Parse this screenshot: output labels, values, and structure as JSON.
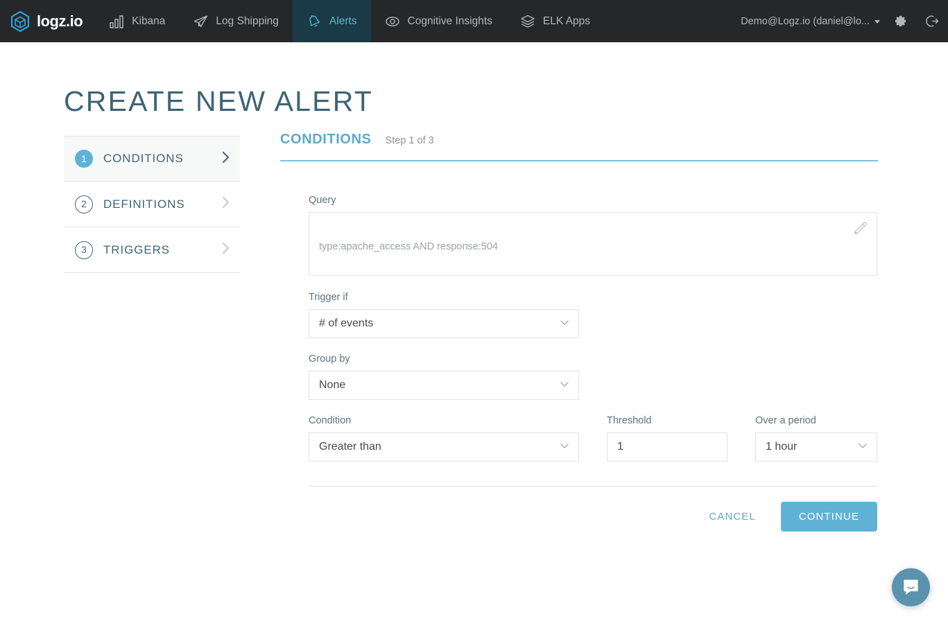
{
  "topnav": {
    "brand": {
      "text": "logz.io",
      "icon": "logzio-cube-icon"
    },
    "items": [
      {
        "label": "Kibana",
        "icon": "bar-chart-icon",
        "active": false
      },
      {
        "label": "Log Shipping",
        "icon": "paper-plane-icon",
        "active": false
      },
      {
        "label": "Alerts",
        "icon": "bell-icon",
        "active": true
      },
      {
        "label": "Cognitive Insights",
        "icon": "eye-icon",
        "active": false
      },
      {
        "label": "ELK Apps",
        "icon": "layers-icon",
        "active": false
      }
    ],
    "user": "Demo@Logz.io (daniel@lo...",
    "settings_icon": "gear-icon",
    "logout_icon": "logout-icon"
  },
  "page": {
    "title": "CREATE NEW ALERT"
  },
  "steps": [
    {
      "number": "1",
      "label": "CONDITIONS",
      "active": true
    },
    {
      "number": "2",
      "label": "DEFINITIONS",
      "active": false
    },
    {
      "number": "3",
      "label": "TRIGGERS",
      "active": false
    }
  ],
  "panel": {
    "title": "CONDITIONS",
    "step_indicator": "Step 1 of 3"
  },
  "form": {
    "query": {
      "label": "Query",
      "placeholder": "type:apache_access AND response:504",
      "value": "",
      "edit_icon": "pencil-icon"
    },
    "trigger_if": {
      "label": "Trigger if",
      "value": "# of events"
    },
    "group_by": {
      "label": "Group by",
      "value": "None"
    },
    "condition": {
      "label": "Condition",
      "value": "Greater than"
    },
    "threshold": {
      "label": "Threshold",
      "value": "1"
    },
    "over_a_period": {
      "label": "Over a period",
      "value": "1 hour"
    }
  },
  "actions": {
    "cancel_label": "CANCEL",
    "continue_label": "CONTINUE"
  },
  "chat": {
    "icon": "chat-bubble-icon"
  },
  "colors": {
    "nav_bg": "#262729",
    "nav_active_bg": "#1b3a47",
    "accent_blue": "#5fb2d6",
    "title_slate": "#3e6375",
    "chat_bg": "#5b92ae"
  }
}
